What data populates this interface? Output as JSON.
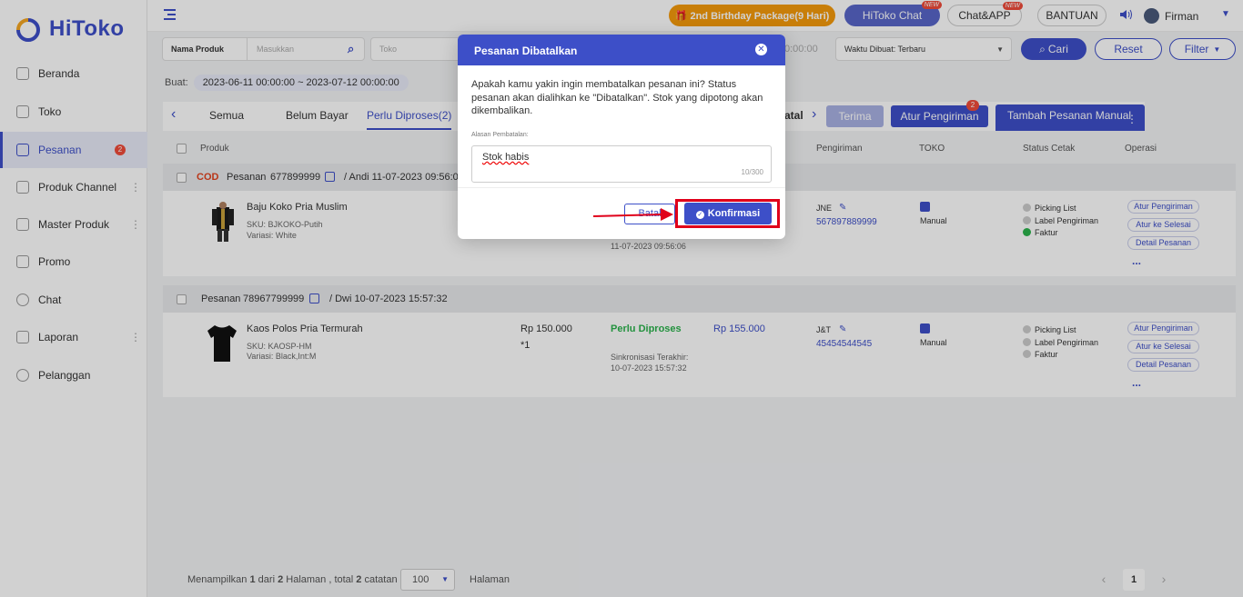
{
  "app": {
    "brand": "HiToko",
    "accent": "#3d4fc8"
  },
  "sidebar": {
    "items": [
      {
        "label": "Beranda",
        "icon": "monitor-icon"
      },
      {
        "label": "Toko",
        "icon": "store-icon"
      },
      {
        "label": "Pesanan",
        "icon": "order-icon",
        "badge": "2",
        "active": true
      },
      {
        "label": "Produk Channel",
        "icon": "grid-icon"
      },
      {
        "label": "Master Produk",
        "icon": "box-icon"
      },
      {
        "label": "Promo",
        "icon": "promo-icon"
      },
      {
        "label": "Chat",
        "icon": "chat-icon"
      },
      {
        "label": "Laporan",
        "icon": "report-icon"
      },
      {
        "label": "Pelanggan",
        "icon": "users-icon"
      }
    ]
  },
  "topbar": {
    "birthday": "🎁 2nd Birthday Package(9 Hari)",
    "hitoko_chat": "HiToko Chat",
    "chat_app": "Chat&APP",
    "new_tag": "NEW",
    "bantuan": "BANTUAN",
    "user": "Firman"
  },
  "filter": {
    "field": "Nama Produk",
    "placeholder": "Masukkan",
    "toko": "Toko",
    "time_partial": "0:00:00",
    "sort": "Waktu Dibuat: Terbaru",
    "search_btn": "Cari",
    "reset_btn": "Reset",
    "filter_btn": "Filter"
  },
  "date": {
    "label": "Buat:",
    "range": "2023-06-11 00:00:00 ~ 2023-07-12 00:00:00"
  },
  "tabs": {
    "semua": "Semua",
    "belum_bayar": "Belum Bayar",
    "perlu_diproses": "Perlu Diproses(2)",
    "batal_partial": "atal",
    "terima": "Terima",
    "atur_pengiriman": "Atur Pengiriman",
    "atur_badge": "2",
    "tambah": "Tambah Pesanan Manual"
  },
  "columns": {
    "produk": "Produk",
    "pengiriman": "Pengiriman",
    "toko": "TOKO",
    "status_cetak": "Status Cetak",
    "operasi": "Operasi"
  },
  "orders": [
    {
      "cod": "COD",
      "label": "Pesanan",
      "id": "677899999",
      "meta": "/ Andi  11-07-2023 09:56:0",
      "name": "Baju Koko Pria Muslim",
      "sku": "SKU:  BJKOKO-Putih",
      "variasi": "Variasi:  White",
      "sync_time": "11-07-2023 09:56:06",
      "courier": "JNE",
      "resi": "567897889999",
      "toko": "Manual",
      "print": [
        "Picking List",
        "Label Pengiriman",
        "Faktur"
      ]
    },
    {
      "label": "Pesanan",
      "id": "78967799999",
      "meta": "/ Dwi  10-07-2023 15:57:32",
      "name": "Kaos Polos Pria Termurah",
      "sku": "SKU:  KAOSP-HM",
      "variasi": "Variasi:  Black,Int:M",
      "price": "Rp 150.000",
      "qty": "*1",
      "status": "Perlu Diproses",
      "total": "Rp 155.000",
      "sync_label": "Sinkronisasi Terakhir:",
      "sync_time": "10-07-2023 15:57:32",
      "courier": "J&T",
      "resi": "45454544545",
      "toko": "Manual",
      "print": [
        "Picking List",
        "Label Pengiriman",
        "Faktur"
      ]
    }
  ],
  "ops": [
    "Atur Pengiriman",
    "Atur ke Selesai",
    "Detail Pesanan",
    "..."
  ],
  "footer": {
    "pre": "Menampilkan ",
    "a": "1",
    "mid1": " dari ",
    "b": "2",
    "mid2": " Halaman , total ",
    "c": "2",
    "post": " catatan",
    "size": "100",
    "halaman": "Halaman",
    "page": "1"
  },
  "modal": {
    "title": "Pesanan Dibatalkan",
    "message": "Apakah kamu yakin ingin membatalkan pesanan ini? Status pesanan akan dialihkan ke \"Dibatalkan\". Stok yang dipotong akan dikembalikan.",
    "reason_label": "Alasan Pembatalan:",
    "reason_value": "Stok habis",
    "counter": "10/300",
    "cancel": "Batal",
    "confirm": "Konfirmasi"
  }
}
